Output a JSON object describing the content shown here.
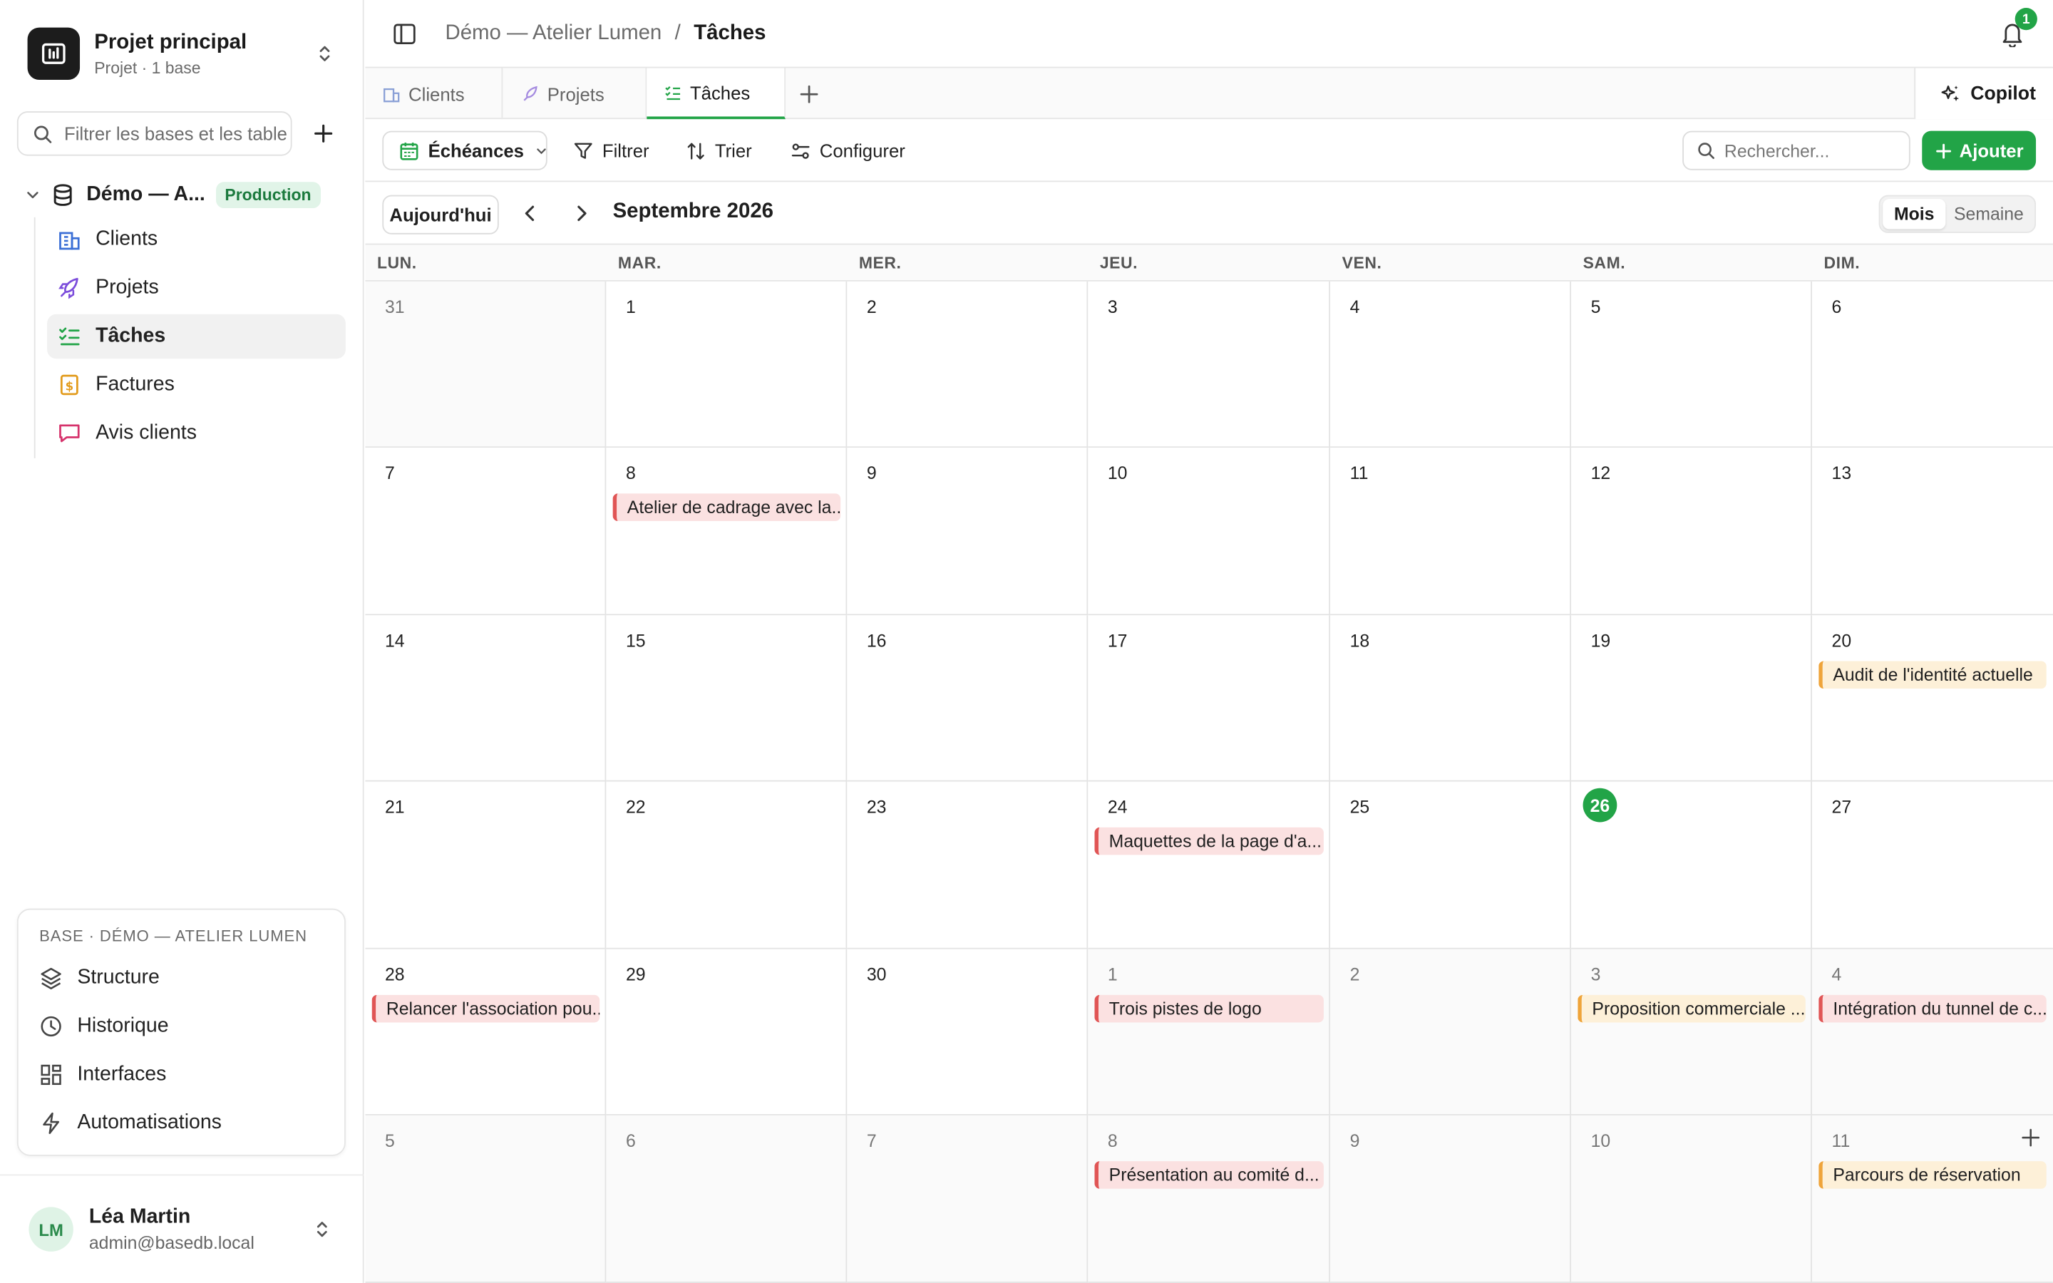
{
  "sidebar": {
    "project_name": "Projet principal",
    "project_sub": "Projet · 1 base",
    "filter_placeholder": "Filtrer les bases et les tables",
    "db_name": "Démo — A...",
    "db_badge": "Production",
    "tables": [
      {
        "label": "Clients",
        "icon": "building-icon",
        "color": "#3b6fd6"
      },
      {
        "label": "Projets",
        "icon": "rocket-icon",
        "color": "#7c4ddb"
      },
      {
        "label": "Tâches",
        "icon": "checklist-icon",
        "color": "#22a447"
      },
      {
        "label": "Factures",
        "icon": "invoice-icon",
        "color": "#e29b1c"
      },
      {
        "label": "Avis clients",
        "icon": "chat-icon",
        "color": "#d6336c"
      }
    ],
    "base_panel_title": "BASE · DÉMO — ATELIER LUMEN",
    "base_items": [
      {
        "label": "Structure",
        "icon": "layers-icon"
      },
      {
        "label": "Historique",
        "icon": "clock-icon"
      },
      {
        "label": "Interfaces",
        "icon": "grid-icon"
      },
      {
        "label": "Automatisations",
        "icon": "bolt-icon"
      }
    ],
    "user": {
      "initials": "LM",
      "name": "Léa Martin",
      "email": "admin@basedb.local"
    }
  },
  "header": {
    "breadcrumb_base": "Démo — Atelier Lumen",
    "breadcrumb_sep": "/",
    "breadcrumb_table": "Tâches",
    "notification_count": "1"
  },
  "tabs": [
    {
      "label": "Clients"
    },
    {
      "label": "Projets"
    },
    {
      "label": "Tâches"
    }
  ],
  "copilot_label": "Copilot",
  "toolbar": {
    "view_label": "Échéances",
    "filter_label": "Filtrer",
    "sort_label": "Trier",
    "configure_label": "Configurer",
    "search_placeholder": "Rechercher...",
    "add_label": "Ajouter"
  },
  "calendar": {
    "today_label": "Aujourd'hui",
    "month_label": "Septembre 2026",
    "view_month": "Mois",
    "view_week": "Semaine",
    "weekdays": [
      "LUN.",
      "MAR.",
      "MER.",
      "JEU.",
      "VEN.",
      "SAM.",
      "DIM."
    ],
    "weeks": [
      [
        {
          "d": "31",
          "out": true
        },
        {
          "d": "1"
        },
        {
          "d": "2"
        },
        {
          "d": "3"
        },
        {
          "d": "4"
        },
        {
          "d": "5"
        },
        {
          "d": "6"
        }
      ],
      [
        {
          "d": "7"
        },
        {
          "d": "8",
          "event": {
            "label": "Atelier de cadrage avec la...",
            "color": "red"
          }
        },
        {
          "d": "9"
        },
        {
          "d": "10"
        },
        {
          "d": "11"
        },
        {
          "d": "12"
        },
        {
          "d": "13"
        }
      ],
      [
        {
          "d": "14"
        },
        {
          "d": "15"
        },
        {
          "d": "16"
        },
        {
          "d": "17"
        },
        {
          "d": "18"
        },
        {
          "d": "19"
        },
        {
          "d": "20",
          "event": {
            "label": "Audit de l'identité actuelle",
            "color": "orange"
          }
        }
      ],
      [
        {
          "d": "21"
        },
        {
          "d": "22"
        },
        {
          "d": "23"
        },
        {
          "d": "24",
          "event": {
            "label": "Maquettes de la page d'a...",
            "color": "red"
          }
        },
        {
          "d": "25"
        },
        {
          "d": "26",
          "today": true
        },
        {
          "d": "27"
        }
      ],
      [
        {
          "d": "28",
          "event": {
            "label": "Relancer l'association pou...",
            "color": "red"
          }
        },
        {
          "d": "29"
        },
        {
          "d": "30"
        },
        {
          "d": "1",
          "out": true,
          "event": {
            "label": "Trois pistes de logo",
            "color": "red"
          }
        },
        {
          "d": "2",
          "out": true
        },
        {
          "d": "3",
          "out": true,
          "event": {
            "label": "Proposition commerciale ...",
            "color": "orange"
          }
        },
        {
          "d": "4",
          "out": true,
          "event": {
            "label": "Intégration du tunnel de c...",
            "color": "red"
          }
        }
      ],
      [
        {
          "d": "5",
          "out": true
        },
        {
          "d": "6",
          "out": true
        },
        {
          "d": "7",
          "out": true
        },
        {
          "d": "8",
          "out": true,
          "event": {
            "label": "Présentation au comité d...",
            "color": "red"
          }
        },
        {
          "d": "9",
          "out": true
        },
        {
          "d": "10",
          "out": true
        },
        {
          "d": "11",
          "out": true,
          "add": true,
          "event": {
            "label": "Parcours de réservation",
            "color": "orange"
          }
        }
      ]
    ]
  }
}
